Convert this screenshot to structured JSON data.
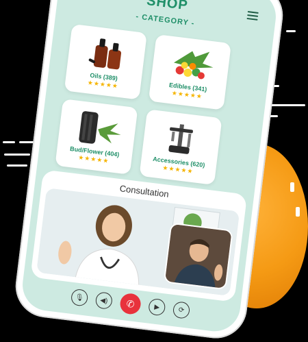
{
  "header": {
    "title": "SHOP",
    "subtitle": "- CATEGORY -"
  },
  "categories": [
    {
      "label": "Oils (389)",
      "stars": "★★★★★",
      "icon": "oil-bottles"
    },
    {
      "label": "Edibles (341)",
      "stars": "★★★★★",
      "icon": "gummies"
    },
    {
      "label": "Bud/Flower (404)",
      "stars": "★★★★★",
      "icon": "vaporizer"
    },
    {
      "label": "Accessories (620)",
      "stars": "★★★★★",
      "icon": "dab-rig"
    }
  ],
  "consultation": {
    "title": "Consultation"
  },
  "call_controls": [
    "microphone-icon",
    "speaker-icon",
    "end-call-icon",
    "video-icon",
    "camera-switch-icon"
  ],
  "colors": {
    "accent": "#1f8f68",
    "screen_bg": "#cdeae1",
    "star": "#f5b400",
    "end_call": "#e8323c",
    "orange_blob": "#f59a14"
  }
}
